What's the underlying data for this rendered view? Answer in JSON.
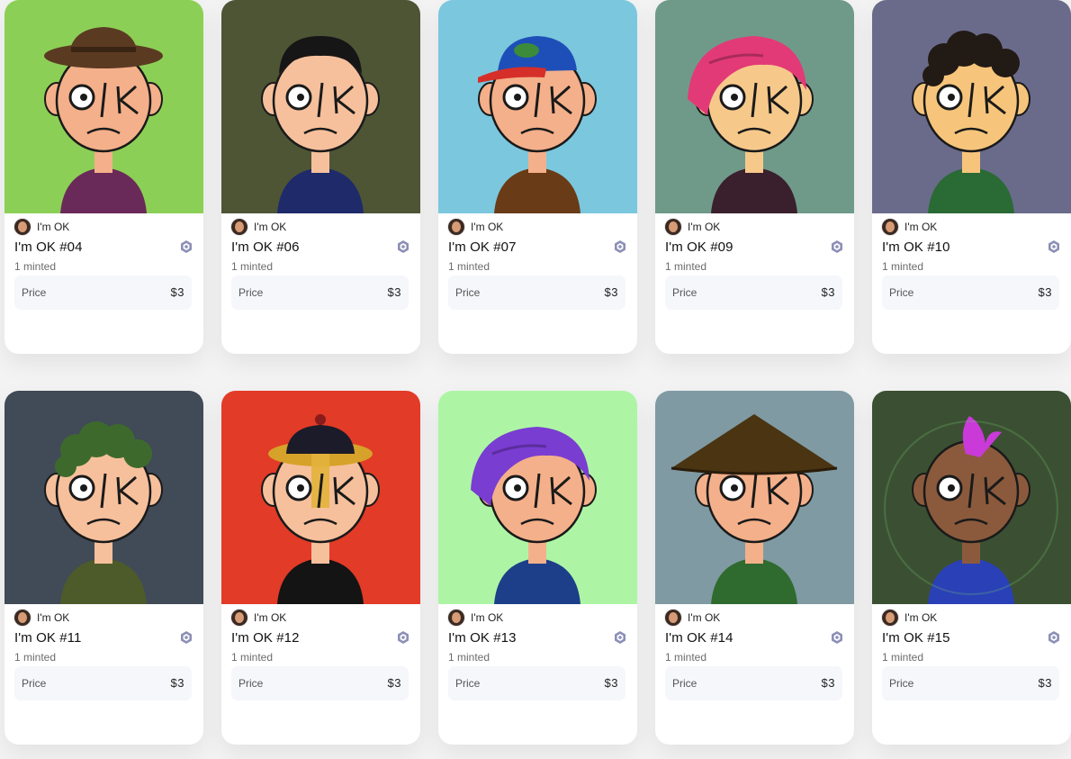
{
  "cards": [
    {
      "creator": "I'm OK",
      "title": "I'm OK #04",
      "minted": "1 minted",
      "price_label": "Price",
      "price": "$3",
      "bg": "#8ccf56",
      "skin": "#f4b08a",
      "shirt": "#6a2a59",
      "hair": "hat",
      "hair_color": "#5b3a22"
    },
    {
      "creator": "I'm OK",
      "title": "I'm OK #06",
      "minted": "1 minted",
      "price_label": "Price",
      "price": "$3",
      "bg": "#4d5535",
      "skin": "#f6c09c",
      "shirt": "#1f2a6b",
      "hair": "short",
      "hair_color": "#161616"
    },
    {
      "creator": "I'm OK",
      "title": "I'm OK #07",
      "minted": "1 minted",
      "price_label": "Price",
      "price": "$3",
      "bg": "#7bc7de",
      "skin": "#f4b08a",
      "shirt": "#6a3b17",
      "hair": "cap",
      "hair_color": "#1e4fb8"
    },
    {
      "creator": "I'm OK",
      "title": "I'm OK #09",
      "minted": "1 minted",
      "price_label": "Price",
      "price": "$3",
      "bg": "#6f9a8a",
      "skin": "#f6c98b",
      "shirt": "#3a1f2c",
      "hair": "long",
      "hair_color": "#e23a77"
    },
    {
      "creator": "I'm OK",
      "title": "I'm OK #10",
      "minted": "1 minted",
      "price_label": "Price",
      "price": "$3",
      "bg": "#6a6b8b",
      "skin": "#f6c57b",
      "shirt": "#2a6a35",
      "hair": "curly",
      "hair_color": "#221a14"
    },
    {
      "creator": "I'm OK",
      "title": "I'm OK #11",
      "minted": "1 minted",
      "price_label": "Price",
      "price": "$3",
      "bg": "#414a57",
      "skin": "#f6c09c",
      "shirt": "#4d5b2a",
      "hair": "curly",
      "hair_color": "#3d6a2c"
    },
    {
      "creator": "I'm OK",
      "title": "I'm OK #12",
      "minted": "1 minted",
      "price_label": "Price",
      "price": "$3",
      "bg": "#e23b27",
      "skin": "#f6c09c",
      "shirt": "#141414",
      "hair": "qing",
      "hair_color": "#1b1b2a"
    },
    {
      "creator": "I'm OK",
      "title": "I'm OK #13",
      "minted": "1 minted",
      "price_label": "Price",
      "price": "$3",
      "bg": "#adf5a4",
      "skin": "#f4b08a",
      "shirt": "#1d3f8a",
      "hair": "long",
      "hair_color": "#7a3dd1"
    },
    {
      "creator": "I'm OK",
      "title": "I'm OK #14",
      "minted": "1 minted",
      "price_label": "Price",
      "price": "$3",
      "bg": "#7f9aa2",
      "skin": "#f4b08a",
      "shirt": "#2f6a2f",
      "hair": "conical",
      "hair_color": "#4a3412"
    },
    {
      "creator": "I'm OK",
      "title": "I'm OK #15",
      "minted": "1 minted",
      "price_label": "Price",
      "price": "$3",
      "bg": "#3b5032",
      "skin": "#8b5a3c",
      "shirt": "#2a40b6",
      "hair": "mohawk",
      "hair_color": "#c93ad9"
    }
  ]
}
